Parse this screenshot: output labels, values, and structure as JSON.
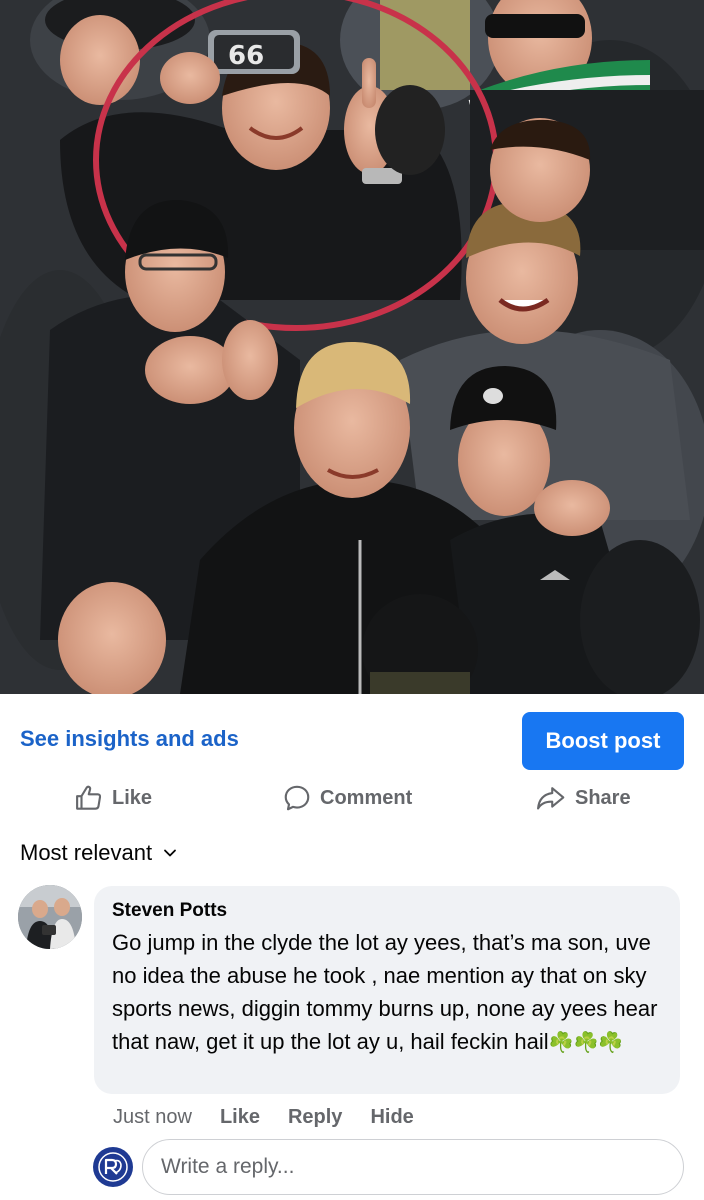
{
  "photo": {
    "phone_screen_text": "66",
    "description_icon": "crowd-photo"
  },
  "insights": {
    "link_label": "See insights and ads",
    "boost_label": "Boost post"
  },
  "actions": {
    "like_label": "Like",
    "comment_label": "Comment",
    "share_label": "Share",
    "like_icon": "thumbs-up-icon",
    "comment_icon": "speech-bubble-icon",
    "share_icon": "share-arrow-icon"
  },
  "sort": {
    "label": "Most relevant",
    "icon": "chevron-down-icon"
  },
  "comment": {
    "author": "Steven Potts",
    "text": "Go jump in the clyde the lot ay yees, that’s ma son, uve no idea the abuse he took , nae mention ay that on sky sports news, diggin tommy burns up, none ay yees hear that naw, get it up the lot ay u, hail feckin hail",
    "clovers": "☘️☘️☘️",
    "timestamp": "Just now",
    "like_label": "Like",
    "reply_label": "Reply",
    "hide_label": "Hide"
  },
  "reply": {
    "placeholder": "Write a reply...",
    "avatar_icon": "club-crest-icon"
  },
  "colors": {
    "accent": "#1877f2",
    "link": "#1b63c8",
    "secondary_text": "#65676b",
    "bubble": "#f0f2f5",
    "circle_highlight": "#c8324a"
  }
}
